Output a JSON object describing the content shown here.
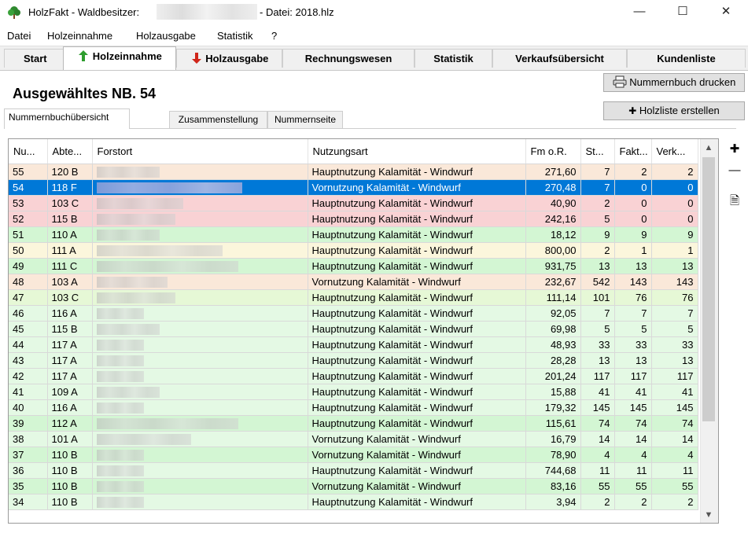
{
  "window": {
    "title_prefix": "HolzFakt - Waldbesitzer:",
    "title_suffix": "- Datei: 2018.hlz",
    "minimize": "—",
    "maximize": "☐",
    "close": "✕"
  },
  "menu": [
    "Datei",
    "Holzeinnahme",
    "Holzausgabe",
    "Statistik",
    "?"
  ],
  "main_tabs": {
    "start": "Start",
    "holzeinnahme": "Holzeinnahme",
    "holzausgabe": "Holzausgabe",
    "rechnungswesen": "Rechnungswesen",
    "statistik": "Statistik",
    "verkaufsuebersicht": "Verkaufsübersicht",
    "kundenliste": "Kundenliste"
  },
  "heading": "Ausgewähltes NB. 54",
  "buttons": {
    "print": "Nummernbuch drucken",
    "create": "Holzliste erstellen"
  },
  "sub_tabs": [
    "Nummernbuchübersicht",
    "Zusammenstellung",
    "Nummernseite"
  ],
  "table": {
    "columns": [
      "Nu...",
      "Abte...",
      "Forstort",
      "Nutzungsart",
      "Fm o.R.",
      "St...",
      "Fakt...",
      "Verk..."
    ],
    "rows": [
      {
        "nr": "55",
        "abt": "120 B",
        "art": "Hauptnutzung Kalamität - Windwurf",
        "fm": "271,60",
        "st": "7",
        "fakt": "2",
        "verk": "2",
        "color": "#fae8d9",
        "bw": 80
      },
      {
        "nr": "54",
        "abt": "118 F",
        "art": "Vornutzung Kalamität - Windwurf",
        "fm": "270,48",
        "st": "7",
        "fakt": "0",
        "verk": "0",
        "color": "#0078d7",
        "bw": 185
      },
      {
        "nr": "53",
        "abt": "103 C",
        "art": "Hauptnutzung Kalamität - Windwurf",
        "fm": "40,90",
        "st": "2",
        "fakt": "0",
        "verk": "0",
        "color": "#f9d2d4",
        "bw": 110
      },
      {
        "nr": "52",
        "abt": "115 B",
        "art": "Hauptnutzung Kalamität - Windwurf",
        "fm": "242,16",
        "st": "5",
        "fakt": "0",
        "verk": "0",
        "color": "#f9d2d4",
        "bw": 100
      },
      {
        "nr": "51",
        "abt": "110 A",
        "art": "Hauptnutzung Kalamität - Windwurf",
        "fm": "18,12",
        "st": "9",
        "fakt": "9",
        "verk": "9",
        "color": "#d3f6d3",
        "bw": 80
      },
      {
        "nr": "50",
        "abt": "111 A",
        "art": "Hauptnutzung Kalamität - Windwurf",
        "fm": "800,00",
        "st": "2",
        "fakt": "1",
        "verk": "1",
        "color": "#fbf6dc",
        "bw": 160
      },
      {
        "nr": "49",
        "abt": "111 C",
        "art": "Hauptnutzung Kalamität - Windwurf",
        "fm": "931,75",
        "st": "13",
        "fakt": "13",
        "verk": "13",
        "color": "#d3f6d3",
        "bw": 180
      },
      {
        "nr": "48",
        "abt": "103 A",
        "art": "Vornutzung Kalamität - Windwurf",
        "fm": "232,67",
        "st": "542",
        "fakt": "143",
        "verk": "143",
        "color": "#fae8d9",
        "bw": 90
      },
      {
        "nr": "47",
        "abt": "103 C",
        "art": "Hauptnutzung Kalamität - Windwurf",
        "fm": "111,14",
        "st": "101",
        "fakt": "76",
        "verk": "76",
        "color": "#e6f8d6",
        "bw": 100
      },
      {
        "nr": "46",
        "abt": "116 A",
        "art": "Hauptnutzung Kalamität - Windwurf",
        "fm": "92,05",
        "st": "7",
        "fakt": "7",
        "verk": "7",
        "color": "#e4f9e4",
        "bw": 60
      },
      {
        "nr": "45",
        "abt": "115 B",
        "art": "Hauptnutzung Kalamität - Windwurf",
        "fm": "69,98",
        "st": "5",
        "fakt": "5",
        "verk": "5",
        "color": "#e4f9e4",
        "bw": 80
      },
      {
        "nr": "44",
        "abt": "117 A",
        "art": "Hauptnutzung Kalamität - Windwurf",
        "fm": "48,93",
        "st": "33",
        "fakt": "33",
        "verk": "33",
        "color": "#e4f9e4",
        "bw": 60
      },
      {
        "nr": "43",
        "abt": "117 A",
        "art": "Hauptnutzung Kalamität - Windwurf",
        "fm": "28,28",
        "st": "13",
        "fakt": "13",
        "verk": "13",
        "color": "#e4f9e4",
        "bw": 60
      },
      {
        "nr": "42",
        "abt": "117 A",
        "art": "Hauptnutzung Kalamität - Windwurf",
        "fm": "201,24",
        "st": "117",
        "fakt": "117",
        "verk": "117",
        "color": "#e4f9e4",
        "bw": 60
      },
      {
        "nr": "41",
        "abt": "109 A",
        "art": "Hauptnutzung Kalamität - Windwurf",
        "fm": "15,88",
        "st": "41",
        "fakt": "41",
        "verk": "41",
        "color": "#e4f9e4",
        "bw": 80
      },
      {
        "nr": "40",
        "abt": "116 A",
        "art": "Hauptnutzung Kalamität - Windwurf",
        "fm": "179,32",
        "st": "145",
        "fakt": "145",
        "verk": "145",
        "color": "#e4f9e4",
        "bw": 60
      },
      {
        "nr": "39",
        "abt": "112 A",
        "art": "Hauptnutzung Kalamität - Windwurf",
        "fm": "115,61",
        "st": "74",
        "fakt": "74",
        "verk": "74",
        "color": "#d3f6d3",
        "bw": 180
      },
      {
        "nr": "38",
        "abt": "101 A",
        "art": "Vornutzung Kalamität - Windwurf",
        "fm": "16,79",
        "st": "14",
        "fakt": "14",
        "verk": "14",
        "color": "#e4f9e4",
        "bw": 120
      },
      {
        "nr": "37",
        "abt": "110 B",
        "art": "Vornutzung Kalamität - Windwurf",
        "fm": "78,90",
        "st": "4",
        "fakt": "4",
        "verk": "4",
        "color": "#d3f6d3",
        "bw": 60
      },
      {
        "nr": "36",
        "abt": "110 B",
        "art": "Hauptnutzung Kalamität - Windwurf",
        "fm": "744,68",
        "st": "11",
        "fakt": "11",
        "verk": "11",
        "color": "#e4f9e4",
        "bw": 60
      },
      {
        "nr": "35",
        "abt": "110 B",
        "art": "Vornutzung Kalamität - Windwurf",
        "fm": "83,16",
        "st": "55",
        "fakt": "55",
        "verk": "55",
        "color": "#d3f6d3",
        "bw": 60
      },
      {
        "nr": "34",
        "abt": "110 B",
        "art": "Hauptnutzung Kalamität - Windwurf",
        "fm": "3,94",
        "st": "2",
        "fakt": "2",
        "verk": "2",
        "color": "#e4f9e4",
        "bw": 60
      }
    ]
  },
  "side_tools": {
    "plus": "✚",
    "minus": "—",
    "doc": "🗎"
  },
  "scroll": {
    "up": "▲",
    "down": "▼"
  }
}
